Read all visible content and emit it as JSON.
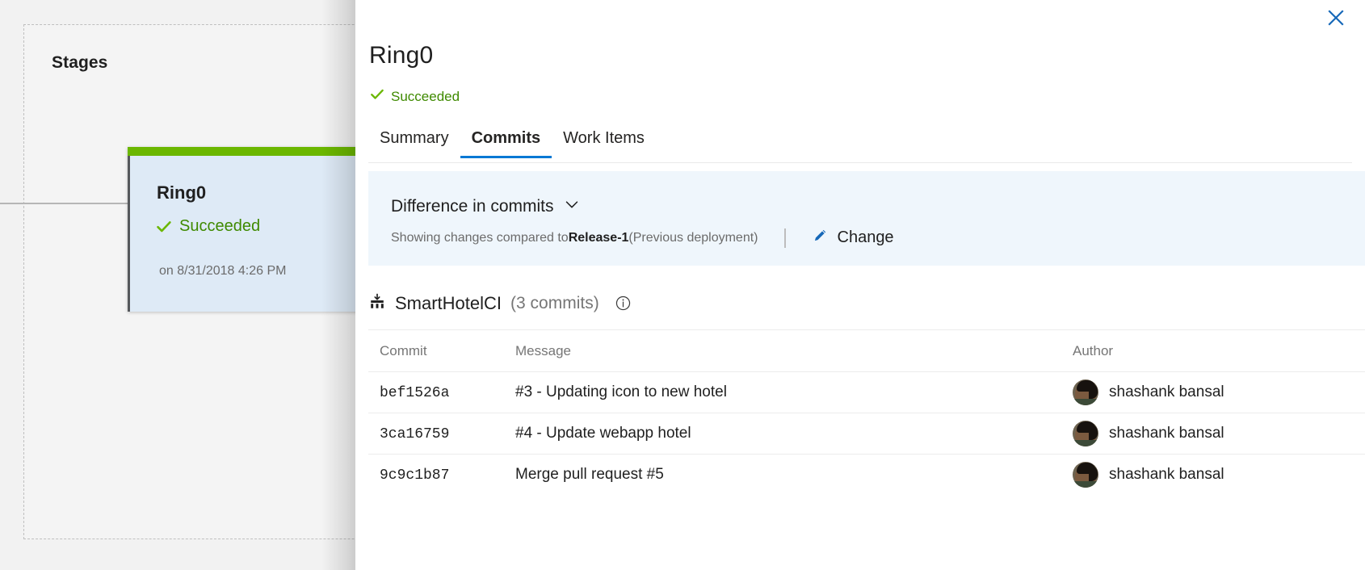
{
  "left_panel": {
    "stages_label": "Stages",
    "stage_card": {
      "title": "Ring0",
      "status": "Succeeded",
      "status_icon": "check-icon",
      "timestamp": "on 8/31/2018 4:26 PM",
      "top_bar_color": "#6bb700",
      "background_color": "#deeaf6"
    }
  },
  "flyout": {
    "close_icon": "close-icon",
    "close_icon_color": "#0078d4",
    "title": "Ring0",
    "status": "Succeeded",
    "status_icon": "check-icon",
    "status_color": "#3f8a00",
    "tabs": [
      {
        "label": "Summary",
        "active": false
      },
      {
        "label": "Commits",
        "active": true
      },
      {
        "label": "Work Items",
        "active": false
      }
    ],
    "accent_color": "#0078d4",
    "banner": {
      "title": "Difference in commits",
      "chevron_icon": "chevron-down-icon",
      "sub_prefix": "Showing changes compared to ",
      "sub_bold": "Release-1",
      "sub_suffix": " (Previous deployment)",
      "change_label": "Change",
      "change_icon": "pencil-icon",
      "background_color": "#eff6fc"
    },
    "repo": {
      "icon": "build-artifact-icon",
      "name": "SmartHotelCI",
      "count": "(3 commits)",
      "info_icon": "info-icon"
    },
    "table": {
      "columns": [
        "Commit",
        "Message",
        "Author"
      ],
      "rows": [
        {
          "commit": "bef1526a",
          "message": "#3 - Updating icon to new hotel",
          "author": "shashank bansal",
          "avatar": "user-avatar"
        },
        {
          "commit": "3ca16759",
          "message": "#4 - Update webapp hotel",
          "author": "shashank bansal",
          "avatar": "user-avatar"
        },
        {
          "commit": "9c9c1b87",
          "message": "Merge pull request #5",
          "author": "shashank bansal",
          "avatar": "user-avatar"
        }
      ]
    }
  }
}
